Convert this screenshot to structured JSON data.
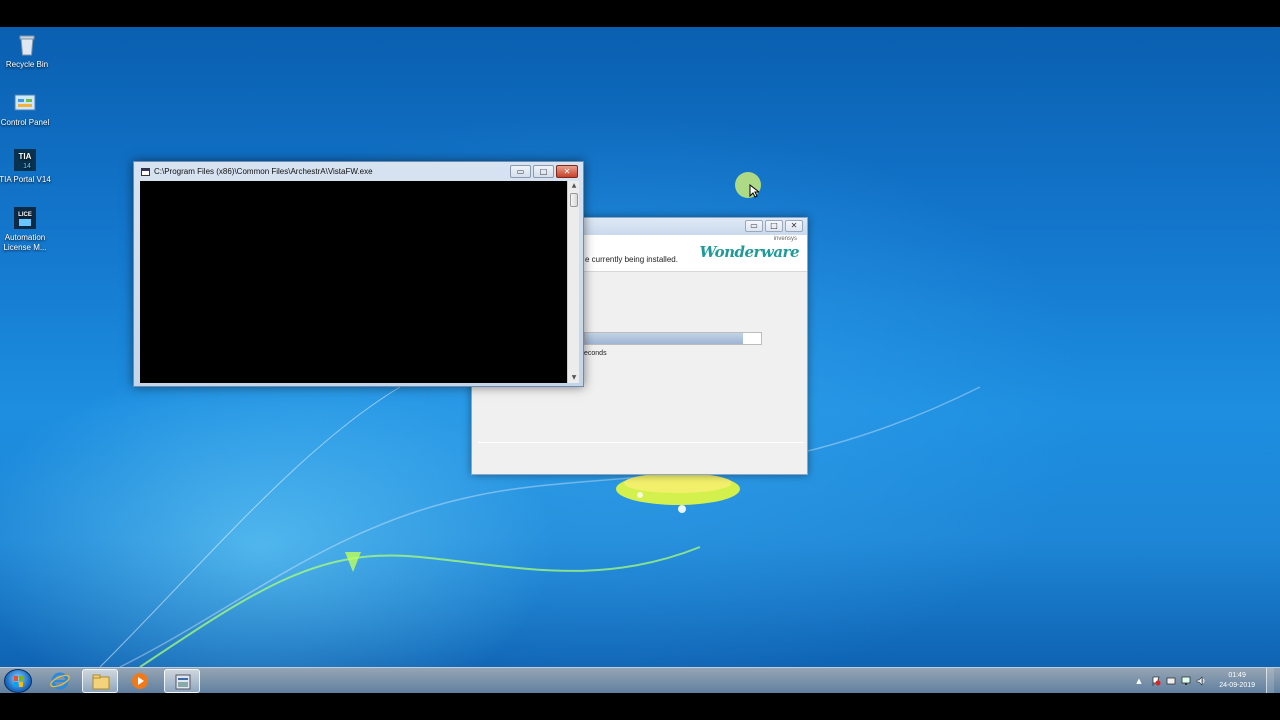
{
  "desktop": {
    "icons": [
      {
        "label": "Recycle Bin",
        "icon": "recycle-bin-icon"
      },
      {
        "label": "Control Panel",
        "icon": "control-panel-icon"
      },
      {
        "label": "TIA Portal V14",
        "icon": "tia-portal-icon"
      },
      {
        "label": "Automation License M...",
        "icon": "license-manager-icon"
      }
    ]
  },
  "console": {
    "title": "C:\\Program Files (x86)\\Common Files\\ArchestrA\\VistaFW.exe",
    "buttons": {
      "minimize": "▭",
      "maximize": "□",
      "close": "✕"
    }
  },
  "installer": {
    "status_text": "e currently being installed.",
    "time_text": "econds",
    "progress": 0.9,
    "brand_small": "invensys",
    "brand_main": "Wonderware",
    "buttons": {
      "minimize": "▭",
      "maximize": "□",
      "close": "✕"
    }
  },
  "taskbar": {
    "apps": [
      "internet-explorer-icon",
      "windows-explorer-icon",
      "media-player-icon",
      "installer-icon"
    ],
    "clock": {
      "time": "01:49",
      "date": "24-09-2019"
    }
  },
  "colors": {
    "accent": "#1f9a9a",
    "close_red": "#c7412a"
  }
}
